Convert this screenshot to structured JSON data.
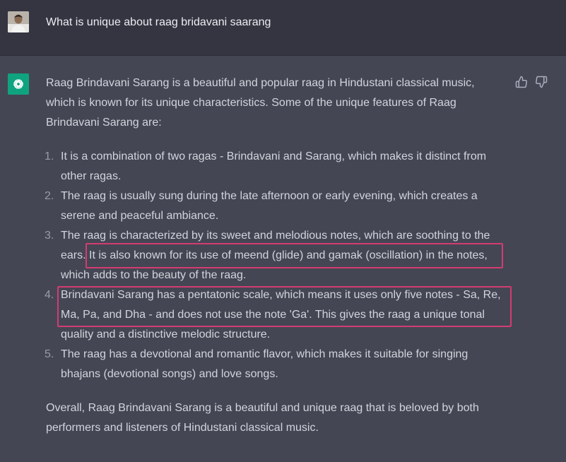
{
  "user": {
    "avatar_icon": "user-avatar",
    "message": "What is unique about raag bridavani saarang"
  },
  "assistant": {
    "icon": "chatgpt-logo-icon",
    "accent": "#10a37f",
    "feedback": [
      "thumbs-up-icon",
      "thumbs-down-icon"
    ],
    "intro_lines": [
      "Raag Brindavani Sarang is a beautiful and popular raag in Hindustani classical music,",
      "which is known for its unique characteristics. Some of the unique features of Raag",
      "Brindavani Sarang are:"
    ],
    "list": [
      {
        "num": "1.",
        "lines": [
          "It is a combination of two ragas - Brindavani and Sarang, which makes it distinct from",
          "other ragas."
        ]
      },
      {
        "num": "2.",
        "lines": [
          "The raag is usually sung during the late afternoon or early evening, which creates a",
          "serene and peaceful ambiance."
        ]
      },
      {
        "num": "3.",
        "lines": [
          "The raag is characterized by its sweet and melodious notes, which are soothing to the",
          "ears. It is also known for its use of meend (glide) and gamak (oscillation) in the notes,",
          "which adds to the beauty of the raag."
        ]
      },
      {
        "num": "4.",
        "lines": [
          "Brindavani Sarang has a pentatonic scale, which means it uses only five notes - Sa, Re,",
          "Ma, Pa, and Dha - and does not use the note 'Ga'. This gives the raag a unique tonal",
          "quality and a distinctive melodic structure."
        ]
      },
      {
        "num": "5.",
        "lines": [
          "The raag has a devotional and romantic flavor, which makes it suitable for singing",
          "bhajans (devotional songs) and love songs."
        ]
      }
    ],
    "outro_lines": [
      "Overall, Raag Brindavani Sarang is a beautiful and unique raag that is beloved by both",
      "performers and listeners of Hindustani classical music."
    ]
  },
  "highlight_color": "#d33c70"
}
